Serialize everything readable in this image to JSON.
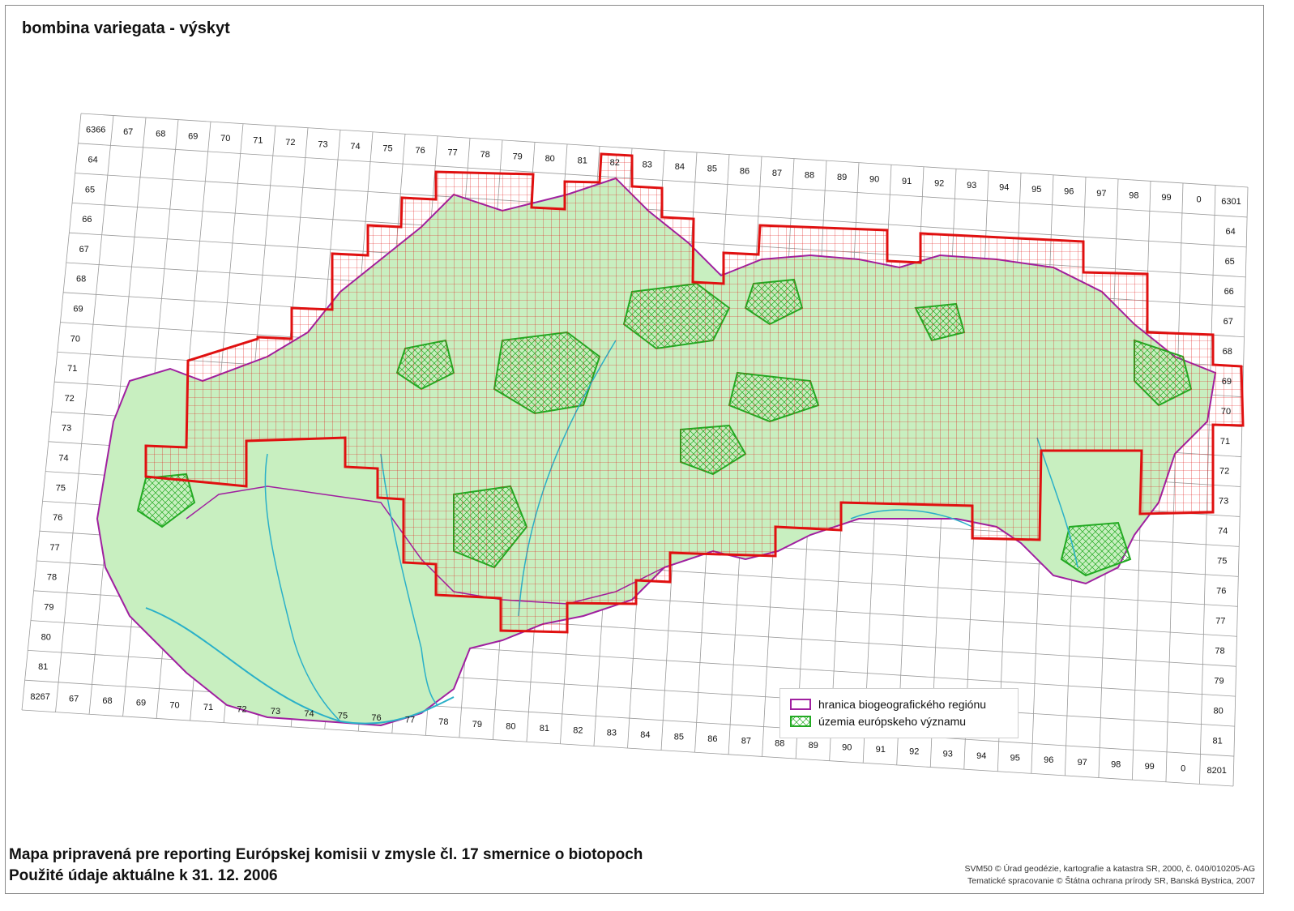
{
  "title": "bombina variegata - výskyt",
  "grid": {
    "top_labels": [
      "6366",
      "67",
      "68",
      "69",
      "70",
      "71",
      "72",
      "73",
      "74",
      "75",
      "76",
      "77",
      "78",
      "79",
      "80",
      "81",
      "82",
      "83",
      "84",
      "85",
      "86",
      "87",
      "88",
      "89",
      "90",
      "91",
      "92",
      "93",
      "94",
      "95",
      "96",
      "97",
      "98",
      "99",
      "0",
      "6301"
    ],
    "bottom_labels": [
      "8267",
      "67",
      "68",
      "69",
      "70",
      "71",
      "72",
      "73",
      "74",
      "75",
      "76",
      "77",
      "78",
      "79",
      "80",
      "81",
      "82",
      "83",
      "84",
      "85",
      "86",
      "87",
      "88",
      "89",
      "90",
      "91",
      "92",
      "93",
      "94",
      "95",
      "96",
      "97",
      "98",
      "99",
      "0",
      "8201"
    ],
    "left_labels": [
      "64",
      "65",
      "66",
      "67",
      "68",
      "69",
      "70",
      "71",
      "72",
      "73",
      "74",
      "75",
      "76",
      "77",
      "78",
      "79",
      "80",
      "81"
    ],
    "right_labels": [
      "64",
      "65",
      "66",
      "67",
      "68",
      "69",
      "70",
      "71",
      "72",
      "73",
      "74",
      "75",
      "76",
      "77",
      "78",
      "79",
      "80",
      "81"
    ]
  },
  "legend": {
    "items": [
      {
        "label": "hranica biogeografického regiónu",
        "color": "#a020a0"
      },
      {
        "label": "územia európskeho významu",
        "color": "#22aa22"
      }
    ]
  },
  "colors": {
    "occurrence": "#e01010",
    "region_border": "#a020a0",
    "eu_sites": "#22aa22",
    "habitat_fill": "#c8efc0",
    "rivers": "#2ab0c8",
    "grid": "#9a9a9a"
  },
  "footer": {
    "line1": "Mapa pripravená pre reporting Európskej komisii v zmysle čl. 17 smernice o biotopoch",
    "line2": "Použité údaje aktuálne k 31. 12. 2006"
  },
  "credits": {
    "line1": "SVM50 © Úrad geodézie, kartografie a katastra SR, 2000, č. 040/010205-AG",
    "line2": "Tematické spracovanie © Štátna ochrana prírody SR, Banská Bystrica, 2007"
  }
}
